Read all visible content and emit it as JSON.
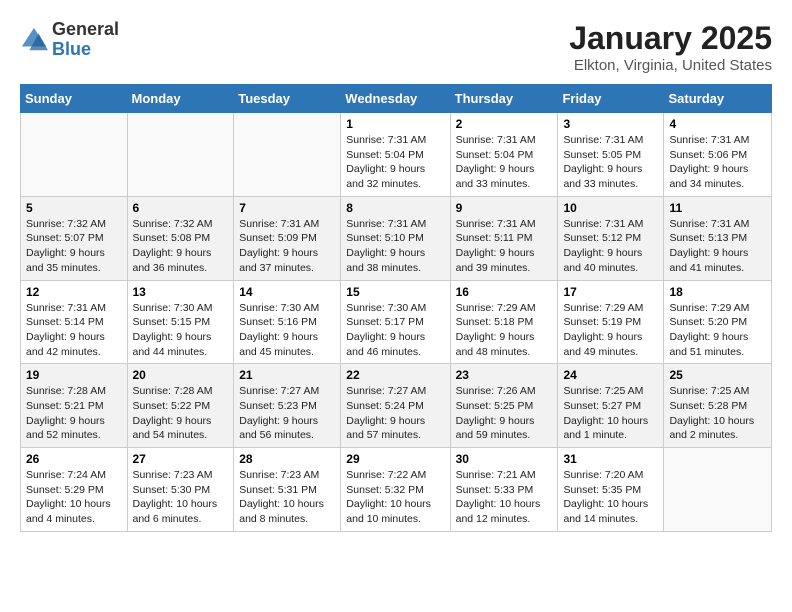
{
  "header": {
    "logo": {
      "line1": "General",
      "line2": "Blue"
    },
    "title": "January 2025",
    "subtitle": "Elkton, Virginia, United States"
  },
  "days_of_week": [
    "Sunday",
    "Monday",
    "Tuesday",
    "Wednesday",
    "Thursday",
    "Friday",
    "Saturday"
  ],
  "weeks": [
    [
      {
        "day": "",
        "info": ""
      },
      {
        "day": "",
        "info": ""
      },
      {
        "day": "",
        "info": ""
      },
      {
        "day": "1",
        "info": "Sunrise: 7:31 AM\nSunset: 5:04 PM\nDaylight: 9 hours and 32 minutes."
      },
      {
        "day": "2",
        "info": "Sunrise: 7:31 AM\nSunset: 5:04 PM\nDaylight: 9 hours and 33 minutes."
      },
      {
        "day": "3",
        "info": "Sunrise: 7:31 AM\nSunset: 5:05 PM\nDaylight: 9 hours and 33 minutes."
      },
      {
        "day": "4",
        "info": "Sunrise: 7:31 AM\nSunset: 5:06 PM\nDaylight: 9 hours and 34 minutes."
      }
    ],
    [
      {
        "day": "5",
        "info": "Sunrise: 7:32 AM\nSunset: 5:07 PM\nDaylight: 9 hours and 35 minutes."
      },
      {
        "day": "6",
        "info": "Sunrise: 7:32 AM\nSunset: 5:08 PM\nDaylight: 9 hours and 36 minutes."
      },
      {
        "day": "7",
        "info": "Sunrise: 7:31 AM\nSunset: 5:09 PM\nDaylight: 9 hours and 37 minutes."
      },
      {
        "day": "8",
        "info": "Sunrise: 7:31 AM\nSunset: 5:10 PM\nDaylight: 9 hours and 38 minutes."
      },
      {
        "day": "9",
        "info": "Sunrise: 7:31 AM\nSunset: 5:11 PM\nDaylight: 9 hours and 39 minutes."
      },
      {
        "day": "10",
        "info": "Sunrise: 7:31 AM\nSunset: 5:12 PM\nDaylight: 9 hours and 40 minutes."
      },
      {
        "day": "11",
        "info": "Sunrise: 7:31 AM\nSunset: 5:13 PM\nDaylight: 9 hours and 41 minutes."
      }
    ],
    [
      {
        "day": "12",
        "info": "Sunrise: 7:31 AM\nSunset: 5:14 PM\nDaylight: 9 hours and 42 minutes."
      },
      {
        "day": "13",
        "info": "Sunrise: 7:30 AM\nSunset: 5:15 PM\nDaylight: 9 hours and 44 minutes."
      },
      {
        "day": "14",
        "info": "Sunrise: 7:30 AM\nSunset: 5:16 PM\nDaylight: 9 hours and 45 minutes."
      },
      {
        "day": "15",
        "info": "Sunrise: 7:30 AM\nSunset: 5:17 PM\nDaylight: 9 hours and 46 minutes."
      },
      {
        "day": "16",
        "info": "Sunrise: 7:29 AM\nSunset: 5:18 PM\nDaylight: 9 hours and 48 minutes."
      },
      {
        "day": "17",
        "info": "Sunrise: 7:29 AM\nSunset: 5:19 PM\nDaylight: 9 hours and 49 minutes."
      },
      {
        "day": "18",
        "info": "Sunrise: 7:29 AM\nSunset: 5:20 PM\nDaylight: 9 hours and 51 minutes."
      }
    ],
    [
      {
        "day": "19",
        "info": "Sunrise: 7:28 AM\nSunset: 5:21 PM\nDaylight: 9 hours and 52 minutes."
      },
      {
        "day": "20",
        "info": "Sunrise: 7:28 AM\nSunset: 5:22 PM\nDaylight: 9 hours and 54 minutes."
      },
      {
        "day": "21",
        "info": "Sunrise: 7:27 AM\nSunset: 5:23 PM\nDaylight: 9 hours and 56 minutes."
      },
      {
        "day": "22",
        "info": "Sunrise: 7:27 AM\nSunset: 5:24 PM\nDaylight: 9 hours and 57 minutes."
      },
      {
        "day": "23",
        "info": "Sunrise: 7:26 AM\nSunset: 5:25 PM\nDaylight: 9 hours and 59 minutes."
      },
      {
        "day": "24",
        "info": "Sunrise: 7:25 AM\nSunset: 5:27 PM\nDaylight: 10 hours and 1 minute."
      },
      {
        "day": "25",
        "info": "Sunrise: 7:25 AM\nSunset: 5:28 PM\nDaylight: 10 hours and 2 minutes."
      }
    ],
    [
      {
        "day": "26",
        "info": "Sunrise: 7:24 AM\nSunset: 5:29 PM\nDaylight: 10 hours and 4 minutes."
      },
      {
        "day": "27",
        "info": "Sunrise: 7:23 AM\nSunset: 5:30 PM\nDaylight: 10 hours and 6 minutes."
      },
      {
        "day": "28",
        "info": "Sunrise: 7:23 AM\nSunset: 5:31 PM\nDaylight: 10 hours and 8 minutes."
      },
      {
        "day": "29",
        "info": "Sunrise: 7:22 AM\nSunset: 5:32 PM\nDaylight: 10 hours and 10 minutes."
      },
      {
        "day": "30",
        "info": "Sunrise: 7:21 AM\nSunset: 5:33 PM\nDaylight: 10 hours and 12 minutes."
      },
      {
        "day": "31",
        "info": "Sunrise: 7:20 AM\nSunset: 5:35 PM\nDaylight: 10 hours and 14 minutes."
      },
      {
        "day": "",
        "info": ""
      }
    ]
  ]
}
